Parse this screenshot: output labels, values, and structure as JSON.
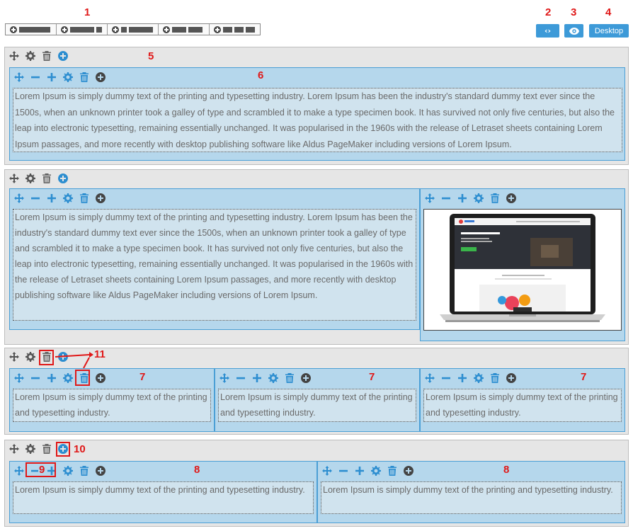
{
  "annotations": {
    "n1": "1",
    "n2": "2",
    "n3": "3",
    "n4": "4",
    "n5": "5",
    "n6": "6",
    "n7a": "7",
    "n7b": "7",
    "n7c": "7",
    "n8a": "8",
    "n8b": "8",
    "n9": "9",
    "n10": "10",
    "n11": "11"
  },
  "toolbar": {
    "layouts": [
      "layout-1",
      "layout-2",
      "layout-3",
      "layout-4",
      "layout-5"
    ],
    "code_icon": "code-icon",
    "preview_icon": "eye-icon",
    "device_label": "Desktop"
  },
  "icons": {
    "move": "move-icon",
    "settings": "gear-icon",
    "delete": "trash-icon",
    "add": "add-circle-icon",
    "shrink": "minus-icon",
    "grow": "plus-icon"
  },
  "content": {
    "long_text": "Lorem Ipsum is simply dummy text of the printing and typesetting industry. Lorem Ipsum has been the industry's standard dummy text ever since the 1500s, when an unknown printer took a galley of type and scrambled it to make a type specimen book. It has survived not only five centuries, but also the leap into electronic typesetting, remaining essentially unchanged. It was popularised in the 1960s with the release of Letraset sheets containing Lorem Ipsum passages, and more recently with desktop publishing software like Aldus PageMaker including versions of Lorem Ipsum.",
    "short_text": "Lorem Ipsum is simply dummy text of the printing and typesetting industry."
  },
  "colors": {
    "accent": "#3d9ad8",
    "column_bg": "#b5d7ec",
    "row_bg": "#e6e6e6",
    "annotation": "#e01818"
  }
}
